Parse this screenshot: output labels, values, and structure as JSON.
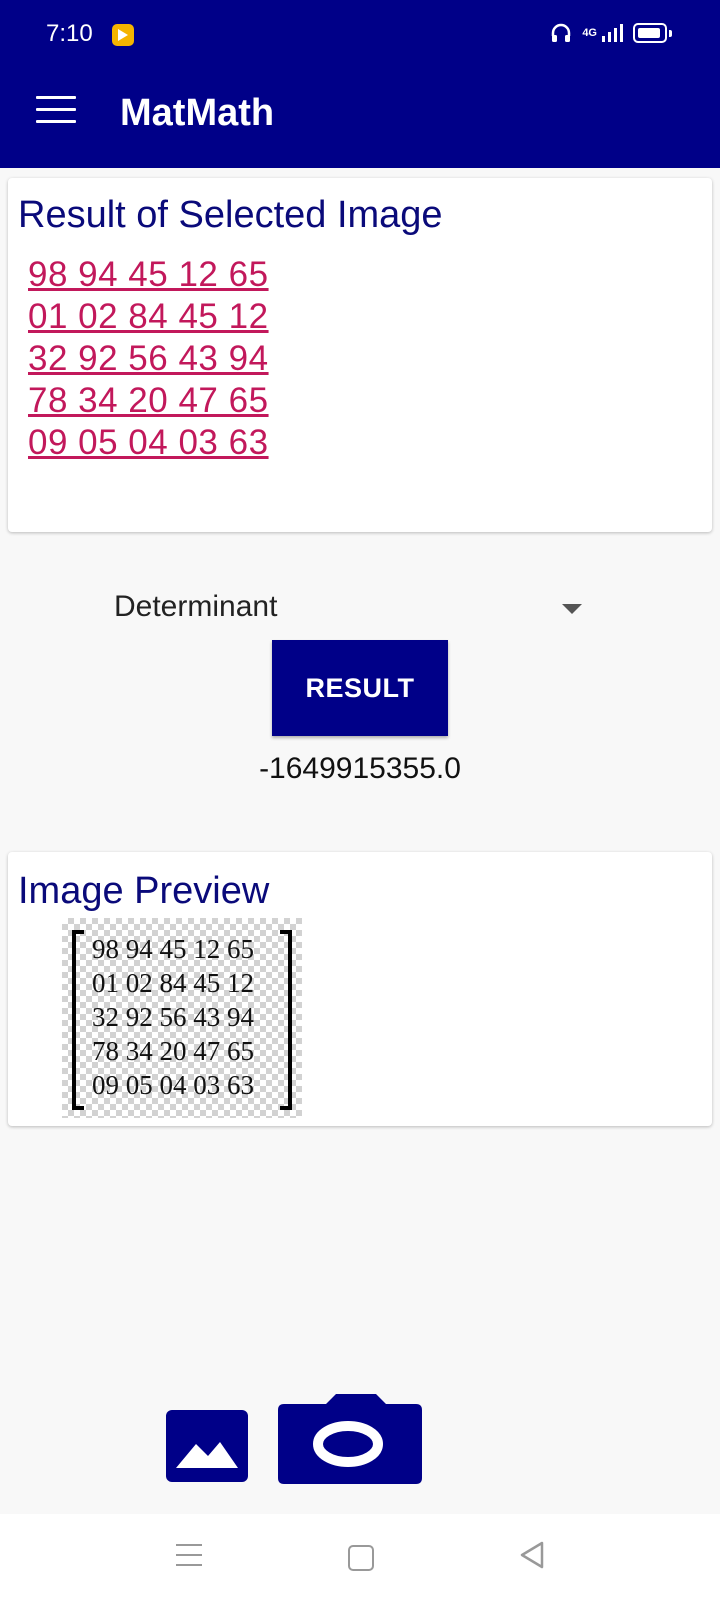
{
  "status_bar": {
    "time": "7:10",
    "network": "4G"
  },
  "app_bar": {
    "title": "MatMath",
    "menu_icon": "hamburger-menu-icon"
  },
  "result_card": {
    "title": "Result of Selected Image",
    "rows": [
      "98 94 45 12 65",
      "01 02 84 45 12",
      "32 92 56 43 94",
      "78 34 20 47 65",
      "09 05 04 03 63"
    ]
  },
  "operation": {
    "selected": "Determinant"
  },
  "result_button": {
    "label": "RESULT"
  },
  "result_value": "-1649915355.0",
  "preview_card": {
    "title": "Image Preview",
    "rows": [
      "98 94 45 12 65",
      "01 02 84 45 12",
      "32 92 56 43 94",
      "78 34 20 47 65",
      "09 05 04 03 63"
    ]
  },
  "actions": {
    "gallery_icon": "image-icon",
    "camera_icon": "camera-icon"
  },
  "colors": {
    "primary": "#000088",
    "link": "#c2185b",
    "title": "#0a0a7a"
  }
}
